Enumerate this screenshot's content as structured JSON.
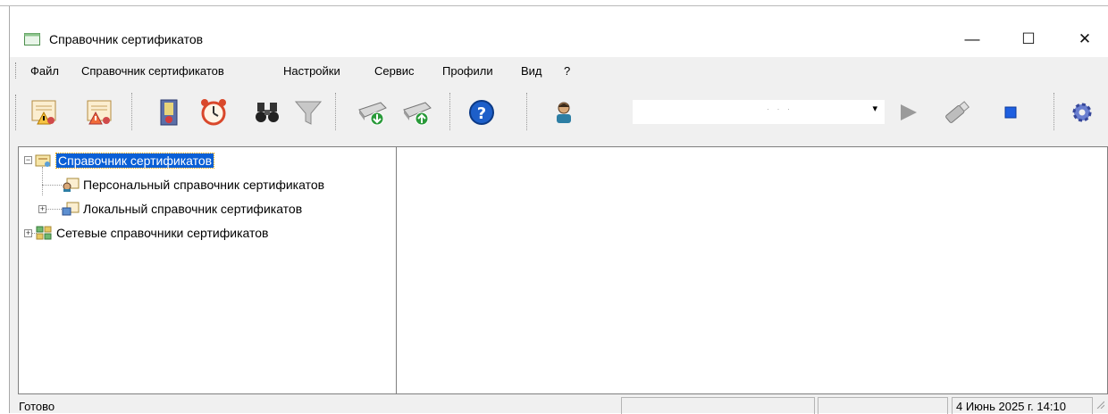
{
  "window": {
    "title": "Справочник сертификатов",
    "minimize": "—",
    "maximize": "☐",
    "close": "✕"
  },
  "menu": {
    "items": [
      "Файл",
      "Справочник сертификатов",
      "Настройки",
      "Сервис",
      "Профили",
      "Вид",
      "?"
    ]
  },
  "toolbar": {
    "profile_combo_value": "",
    "combo_arrow": "▾",
    "icons": [
      "certificate-warning-icon",
      "certificate-warning-icon",
      "revocation-list-icon",
      "alarm-clock-icon",
      "binoculars-icon",
      "filter-icon",
      "import-drive-icon",
      "export-drive-icon",
      "help-icon",
      "user-icon",
      "play-icon",
      "usb-token-icon",
      "stop-icon",
      "settings-gear-icon"
    ]
  },
  "tree": {
    "root": {
      "label": "Справочник сертификатов",
      "expanded": true,
      "children": [
        {
          "label": "Персональный справочник сертификатов"
        },
        {
          "label": "Локальный справочник сертификатов",
          "expanded": false
        }
      ]
    },
    "network": {
      "label": "Сетевые справочники сертификатов",
      "expanded": false
    }
  },
  "status": {
    "text": "Готово",
    "datetime": "4 Июнь 2025 г. 14:10"
  },
  "colors": {
    "selection": "#0a5fd6",
    "chrome": "#f0f0f0"
  }
}
